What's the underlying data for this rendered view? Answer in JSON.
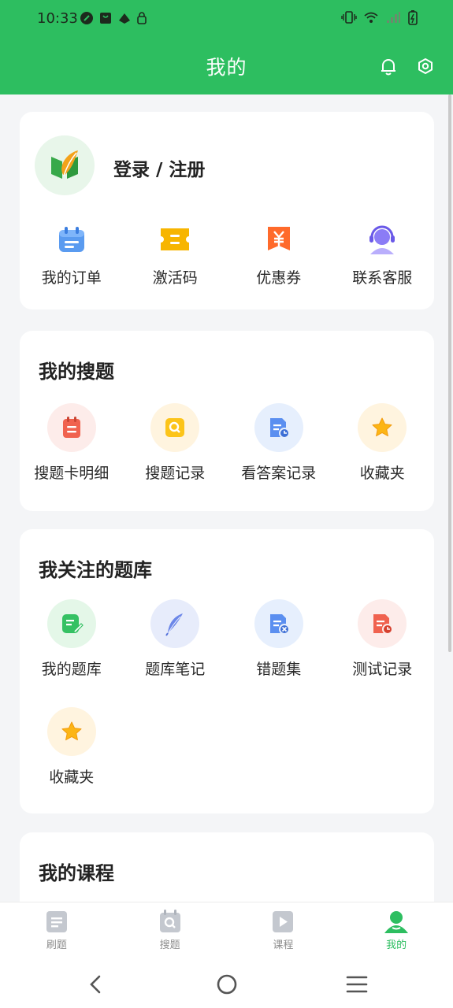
{
  "status_bar": {
    "time": "10:33"
  },
  "header": {
    "title": "我的"
  },
  "login": {
    "label": "登录 / 注册"
  },
  "quick": [
    {
      "label": "我的订单",
      "icon": "calendar-order-icon"
    },
    {
      "label": "激活码",
      "icon": "ticket-icon"
    },
    {
      "label": "优惠券",
      "icon": "coupon-icon"
    },
    {
      "label": "联系客服",
      "icon": "headset-icon"
    }
  ],
  "search_section": {
    "title": "我的搜题",
    "items": [
      {
        "label": "搜题卡明细",
        "icon": "card-detail-icon"
      },
      {
        "label": "搜题记录",
        "icon": "search-record-icon"
      },
      {
        "label": "看答案记录",
        "icon": "answer-record-icon"
      },
      {
        "label": "收藏夹",
        "icon": "star-icon"
      }
    ]
  },
  "bank_section": {
    "title": "我关注的题库",
    "items": [
      {
        "label": "我的题库",
        "icon": "edit-doc-icon"
      },
      {
        "label": "题库笔记",
        "icon": "feather-icon"
      },
      {
        "label": "错题集",
        "icon": "wrong-doc-icon"
      },
      {
        "label": "测试记录",
        "icon": "test-record-icon"
      },
      {
        "label": "收藏夹",
        "icon": "star-icon"
      }
    ]
  },
  "course_section": {
    "title": "我的课程"
  },
  "tabs": [
    {
      "label": "刷题",
      "icon": "doc-tab-icon"
    },
    {
      "label": "搜题",
      "icon": "search-tab-icon"
    },
    {
      "label": "课程",
      "icon": "play-tab-icon"
    },
    {
      "label": "我的",
      "icon": "user-tab-icon",
      "active": true
    }
  ],
  "colors": {
    "brand": "#2dbe60",
    "background": "#f4f5f7"
  }
}
